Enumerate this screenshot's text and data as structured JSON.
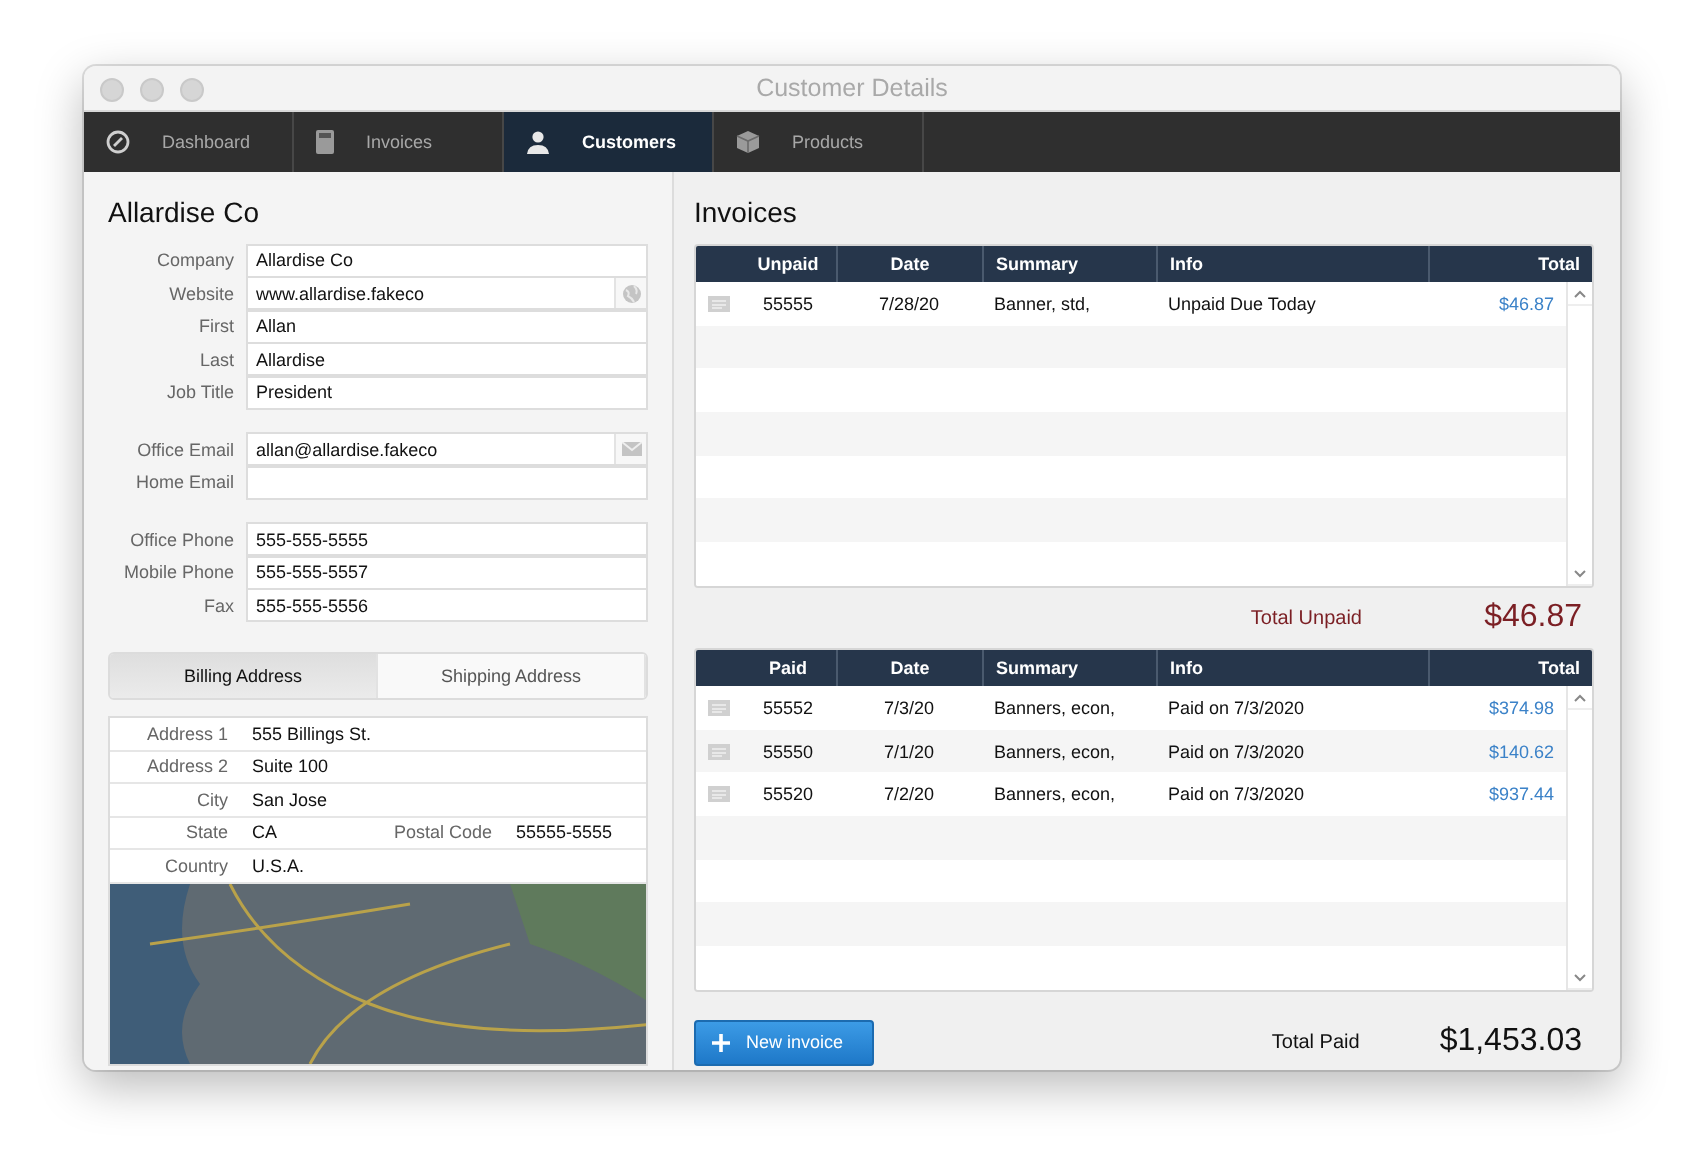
{
  "window": {
    "title": "Customer Details"
  },
  "nav_tabs": [
    {
      "label": "Dashboard",
      "kind": "gauge",
      "selected": false
    },
    {
      "label": "Invoices",
      "kind": "calculator",
      "selected": false
    },
    {
      "label": "Customers",
      "kind": "person",
      "selected": true
    },
    {
      "label": "Products",
      "kind": "box",
      "selected": false
    }
  ],
  "customer": {
    "name": "Allardise Co",
    "field_groups": [
      [
        {
          "label": "Company",
          "value": "Allardise Co",
          "kind": "plain"
        },
        {
          "label": "Website",
          "value": "www.allardise.fakeco",
          "kind": "web"
        },
        {
          "label": "First",
          "value": "Allan",
          "kind": "plain"
        },
        {
          "label": "Last",
          "value": "Allardise",
          "kind": "plain"
        },
        {
          "label": "Job Title",
          "value": "President",
          "kind": "plain"
        }
      ],
      [
        {
          "label": "Office Email",
          "value": "allan@allardise.fakeco",
          "kind": "email"
        },
        {
          "label": "Home Email",
          "kind": "plain"
        }
      ],
      [
        {
          "label": "Office Phone",
          "value": "555-555-5555",
          "kind": "plain"
        },
        {
          "label": "Mobile Phone",
          "value": "555-555-5557",
          "kind": "plain"
        },
        {
          "label": "Fax",
          "value": "555-555-5556",
          "kind": "plain"
        }
      ]
    ]
  },
  "address_tabs": [
    {
      "label": "Billing Address",
      "selected": true
    },
    {
      "label": "Shipping Address",
      "selected": false
    }
  ],
  "address": {
    "rows": [
      {
        "label": "Address 1",
        "value": "555 Billings St."
      },
      {
        "label": "Address 2",
        "value": "Suite 100"
      },
      {
        "label": "City",
        "value": "San Jose"
      },
      {
        "label": "State",
        "value": "CA",
        "extra_label": "Postal Code",
        "extra_value": "55555-5555"
      },
      {
        "label": "Country",
        "value": "U.S.A."
      }
    ]
  },
  "invoices": {
    "title": "Invoices",
    "tables": [
      {
        "kind": "unpaid",
        "columns": [
          "Unpaid",
          "Date",
          "Summary",
          "Info",
          "Total"
        ],
        "rows": [
          [
            "55555",
            "7/28/20",
            "Banner, std,",
            "Unpaid Due Today",
            "$46.87"
          ]
        ],
        "total_label": "Total Unpaid",
        "total": "$46.87"
      },
      {
        "kind": "paid",
        "columns": [
          "Paid",
          "Date",
          "Summary",
          "Info",
          "Total"
        ],
        "rows": [
          [
            "55552",
            "7/3/20",
            "Banners, econ,",
            "Paid on 7/3/2020",
            "$374.98"
          ],
          [
            "55550",
            "7/1/20",
            "Banners, econ,",
            "Paid on 7/3/2020",
            "$140.62"
          ],
          [
            "55520",
            "7/2/20",
            "Banners, econ,",
            "Paid on 7/3/2020",
            "$937.44"
          ]
        ],
        "total_label": "Total Paid",
        "total": "$1,453.03"
      }
    ]
  },
  "new_invoice_button": "New invoice"
}
